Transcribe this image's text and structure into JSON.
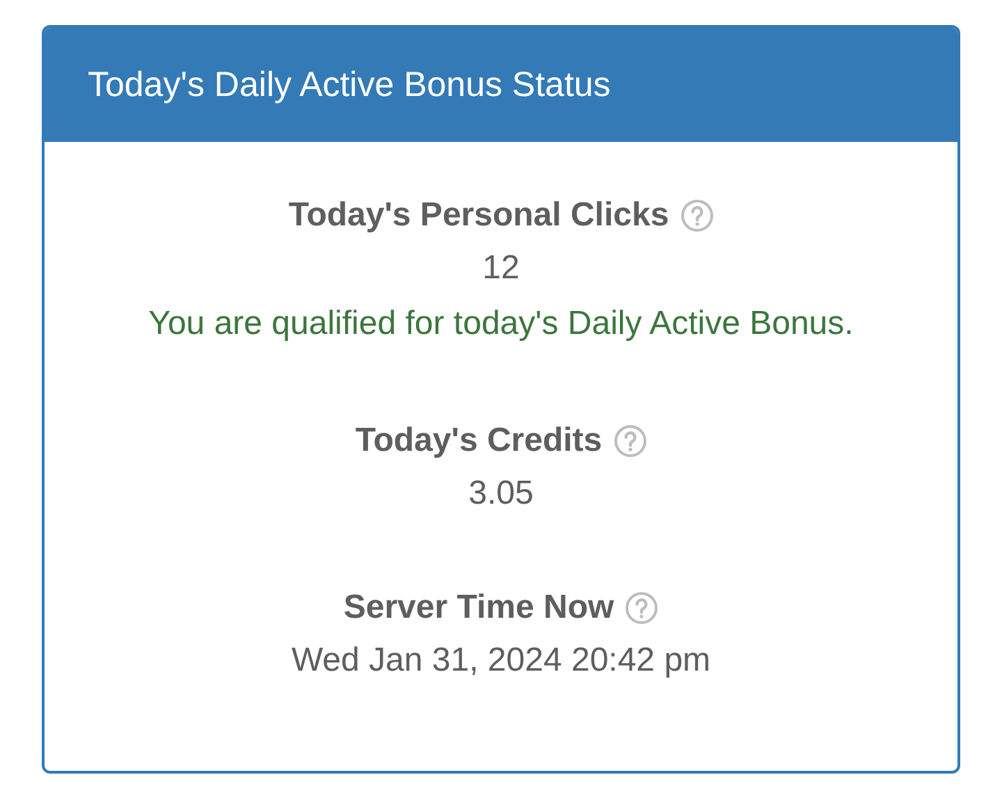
{
  "panel": {
    "title": "Today's Daily Active Bonus Status"
  },
  "stats": [
    {
      "label": "Today's Personal Clicks",
      "value": "12",
      "note": {
        "text": "You are qualified for today's Daily Active Bonus.",
        "kind": "success"
      }
    },
    {
      "label": "Today's Credits",
      "value": "3.05"
    },
    {
      "label": "Server Time Now",
      "value": "Wed Jan 31, 2024 20:42 pm"
    }
  ]
}
